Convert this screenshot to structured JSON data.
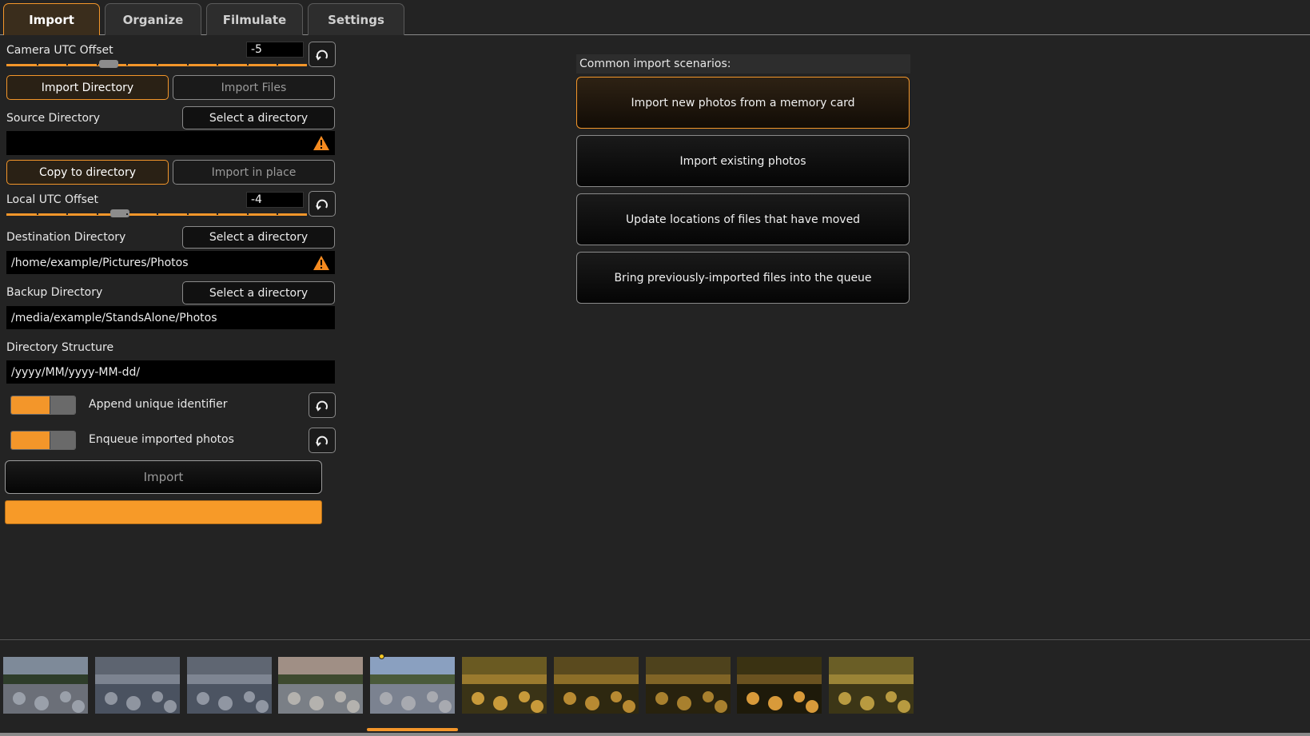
{
  "tabs": [
    {
      "label": "Import",
      "active": true
    },
    {
      "label": "Organize",
      "active": false
    },
    {
      "label": "Filmulate",
      "active": false
    },
    {
      "label": "Settings",
      "active": false
    }
  ],
  "import": {
    "camera_utc": {
      "label": "Camera UTC Offset",
      "value": "-5",
      "slider_fraction": 0.33
    },
    "mode": {
      "import_directory": "Import Directory",
      "import_files": "Import Files",
      "selected": "import_directory"
    },
    "source": {
      "label": "Source Directory",
      "button": "Select a directory",
      "path": ""
    },
    "copy_mode": {
      "copy_to_directory": "Copy to directory",
      "import_in_place": "Import in place",
      "selected": "copy_to_directory"
    },
    "local_utc": {
      "label": "Local UTC Offset",
      "value": "-4",
      "slider_fraction": 0.37
    },
    "destination": {
      "label": "Destination Directory",
      "button": "Select a directory",
      "path": "/home/example/Pictures/Photos"
    },
    "backup": {
      "label": "Backup Directory",
      "button": "Select a directory",
      "path": "/media/example/StandsAlone/Photos"
    },
    "structure": {
      "label": "Directory Structure",
      "value": "/yyyy/MM/yyyy-MM-dd/"
    },
    "append_unique": {
      "label": "Append unique identifier",
      "enabled": true
    },
    "enqueue": {
      "label": "Enqueue imported photos",
      "enabled": true
    },
    "import_button": "Import",
    "progress": 1.0
  },
  "scenarios": {
    "heading": "Common import scenarios:",
    "items": [
      {
        "label": "Import new photos from a memory card",
        "selected": true
      },
      {
        "label": "Import existing photos",
        "selected": false
      },
      {
        "label": "Update locations of files that have moved",
        "selected": false
      },
      {
        "label": "Bring previously-imported files into the queue",
        "selected": false
      }
    ]
  },
  "filmstrip": {
    "count": 10,
    "selected_index": 4,
    "flagged_index": 4
  },
  "colors": {
    "accent": "#f3962a",
    "background": "#232323",
    "warning": "#f58a1f"
  },
  "icons": {
    "reset": "reset-icon",
    "warning": "warning-icon"
  }
}
